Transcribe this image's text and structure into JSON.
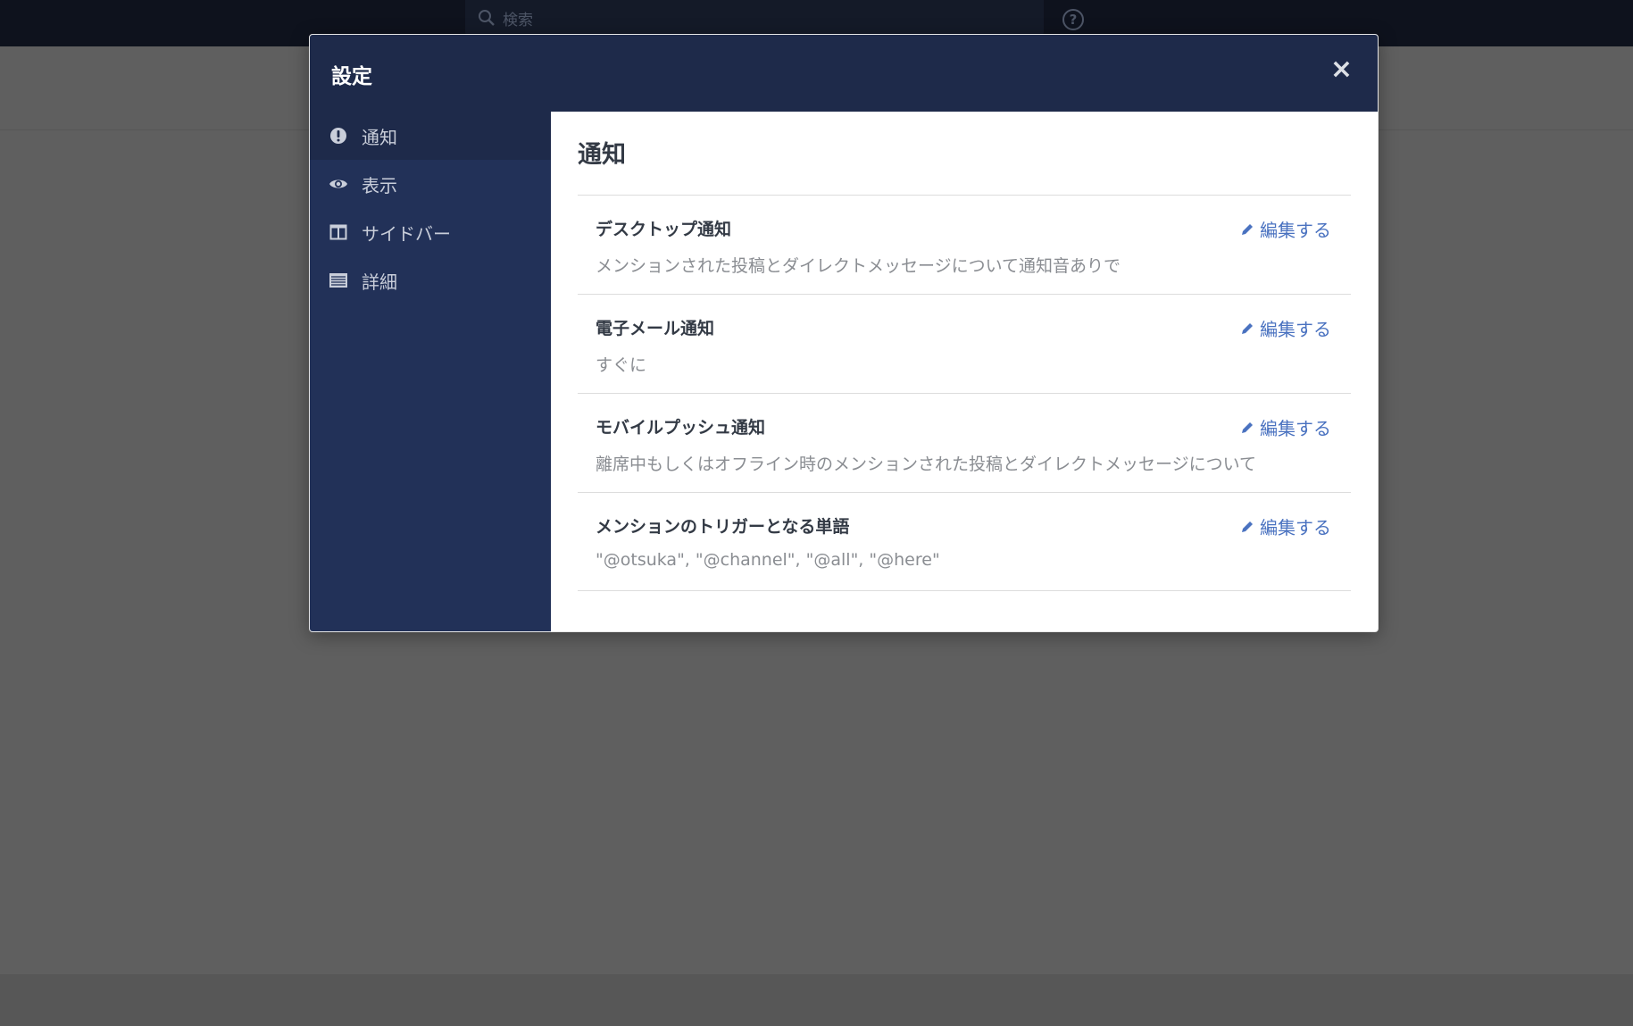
{
  "topbar": {
    "search_placeholder": "検索",
    "help_label": "?"
  },
  "modal": {
    "title": "設定",
    "close_label": "×",
    "sidebar": {
      "items": [
        {
          "label": "通知",
          "icon": "exclamation-circle-icon",
          "active": true
        },
        {
          "label": "表示",
          "icon": "eye-icon"
        },
        {
          "label": "サイドバー",
          "icon": "columns-icon"
        },
        {
          "label": "詳細",
          "icon": "list-icon"
        }
      ]
    },
    "content": {
      "title": "通知",
      "edit_label": "編集する",
      "rows": [
        {
          "title": "デスクトップ通知",
          "desc": "メンションされた投稿とダイレクトメッセージについて通知音ありで"
        },
        {
          "title": "電子メール通知",
          "desc": "すぐに"
        },
        {
          "title": "モバイルプッシュ通知",
          "desc": "離席中もしくはオフライン時のメンションされた投稿とダイレクトメッセージについて"
        },
        {
          "title": "メンションのトリガーとなる単語",
          "desc": "\"@otsuka\", \"@channel\", \"@all\", \"@here\""
        }
      ]
    }
  },
  "colors": {
    "header": "#1e2a4a",
    "sidebar": "#223158",
    "link": "#4a72c0"
  }
}
